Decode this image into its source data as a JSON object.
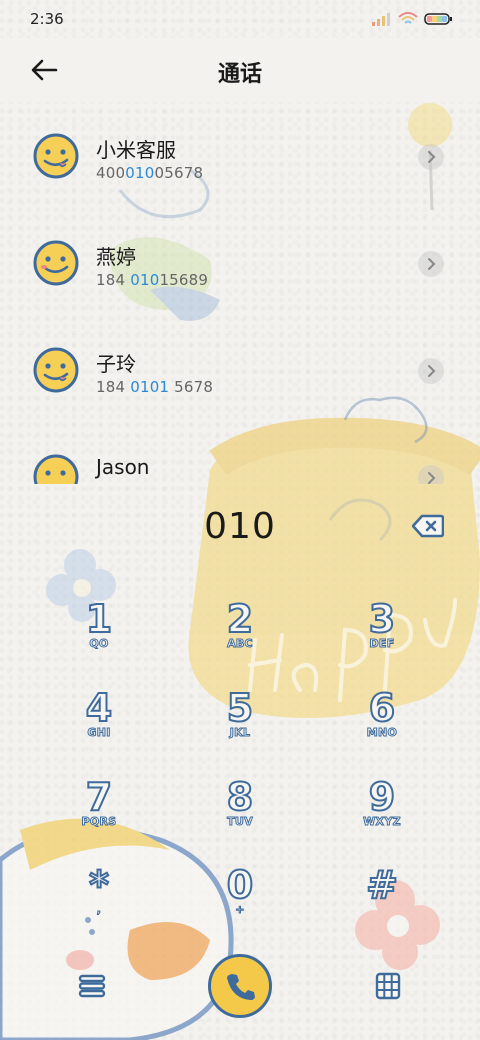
{
  "status": {
    "time": "2:36"
  },
  "header": {
    "title": "通话"
  },
  "contacts": [
    {
      "name": "小米客服",
      "num_pre": "400",
      "num_hl": "010",
      "num_post": "05678"
    },
    {
      "name": "燕婷",
      "num_pre": "184 ",
      "num_hl": "010",
      "num_post": "15689"
    },
    {
      "name": "子玲",
      "num_pre": "184 ",
      "num_hl": "0101",
      "num_post": " 5678"
    },
    {
      "name": "Jason",
      "num_pre": "",
      "num_hl": "",
      "num_post": ""
    }
  ],
  "dialer": {
    "display": "010",
    "keys": [
      {
        "digit": "1",
        "letters": "QO"
      },
      {
        "digit": "2",
        "letters": "ABC"
      },
      {
        "digit": "3",
        "letters": "DEF"
      },
      {
        "digit": "4",
        "letters": "GHI"
      },
      {
        "digit": "5",
        "letters": "JKL"
      },
      {
        "digit": "6",
        "letters": "MNO"
      },
      {
        "digit": "7",
        "letters": "PQRS"
      },
      {
        "digit": "8",
        "letters": "TUV"
      },
      {
        "digit": "9",
        "letters": "WXYZ"
      },
      {
        "digit": "*",
        "letters": ","
      },
      {
        "digit": "0",
        "letters": "+"
      },
      {
        "digit": "#",
        "letters": ""
      }
    ]
  },
  "background": {
    "text": "HaPPY"
  },
  "colors": {
    "accent_blue": "#2a8ad8",
    "key_outline": "#3f6b9c",
    "call_button": "#f4c94a",
    "avatar_yellow": "#f6cf57"
  },
  "icons": {
    "back": "arrow-left-icon",
    "chevron": "chevron-right-icon",
    "delete": "backspace-icon",
    "menu": "menu-icon",
    "call": "phone-icon",
    "keypad": "keypad-icon"
  }
}
